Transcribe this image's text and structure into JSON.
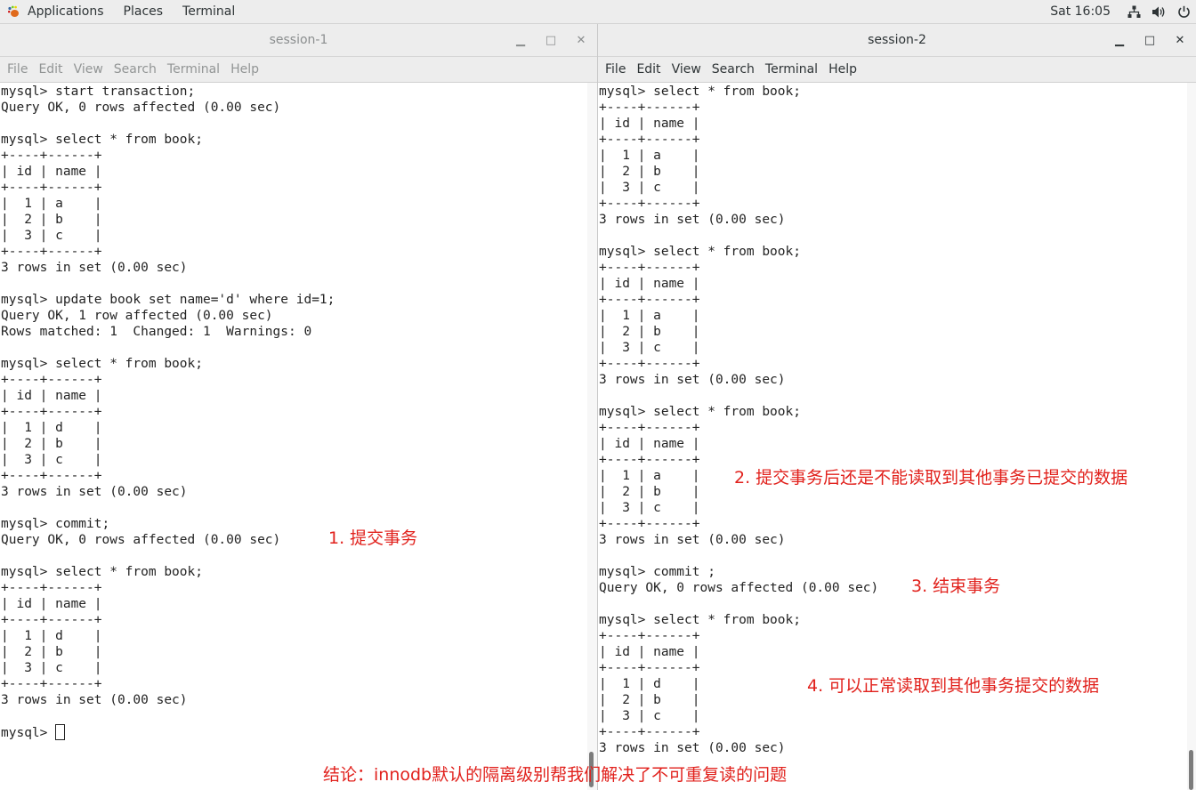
{
  "topbar": {
    "applications_label": "Applications",
    "places_label": "Places",
    "terminal_label": "Terminal",
    "clock": "Sat 16:05"
  },
  "menu_labels": [
    "File",
    "Edit",
    "View",
    "Search",
    "Terminal",
    "Help"
  ],
  "session1": {
    "title": "session-1",
    "output": "mysql> start transaction;\nQuery OK, 0 rows affected (0.00 sec)\n\nmysql> select * from book;\n+----+------+\n| id | name |\n+----+------+\n|  1 | a    |\n|  2 | b    |\n|  3 | c    |\n+----+------+\n3 rows in set (0.00 sec)\n\nmysql> update book set name='d' where id=1;\nQuery OK, 1 row affected (0.00 sec)\nRows matched: 1  Changed: 1  Warnings: 0\n\nmysql> select * from book;\n+----+------+\n| id | name |\n+----+------+\n|  1 | d    |\n|  2 | b    |\n|  3 | c    |\n+----+------+\n3 rows in set (0.00 sec)\n\nmysql> commit;\nQuery OK, 0 rows affected (0.00 sec)\n\nmysql> select * from book;\n+----+------+\n| id | name |\n+----+------+\n|  1 | d    |\n|  2 | b    |\n|  3 | c    |\n+----+------+\n3 rows in set (0.00 sec)\n\n",
    "prompt": "mysql> "
  },
  "session2": {
    "title": "session-2",
    "output": "mysql> select * from book;\n+----+------+\n| id | name |\n+----+------+\n|  1 | a    |\n|  2 | b    |\n|  3 | c    |\n+----+------+\n3 rows in set (0.00 sec)\n\nmysql> select * from book;\n+----+------+\n| id | name |\n+----+------+\n|  1 | a    |\n|  2 | b    |\n|  3 | c    |\n+----+------+\n3 rows in set (0.00 sec)\n\nmysql> select * from book;\n+----+------+\n| id | name |\n+----+------+\n|  1 | a    |\n|  2 | b    |\n|  3 | c    |\n+----+------+\n3 rows in set (0.00 sec)\n\nmysql> commit ;\nQuery OK, 0 rows affected (0.00 sec)\n\nmysql> select * from book;\n+----+------+\n| id | name |\n+----+------+\n|  1 | d    |\n|  2 | b    |\n|  3 | c    |\n+----+------+\n3 rows in set (0.00 sec)"
  },
  "annotations": {
    "step1": "1. 提交事务",
    "step2": "2. 提交事务后还是不能读取到其他事务已提交的数据",
    "step3": "3. 结束事务",
    "step4": "4. 可以正常读取到其他事务提交的数据",
    "conclusion": "结论：innodb默认的隔离级别帮我们解决了不可重复读的问题"
  },
  "colors": {
    "annotation": "#e1211c",
    "chrome": "#ededed"
  }
}
